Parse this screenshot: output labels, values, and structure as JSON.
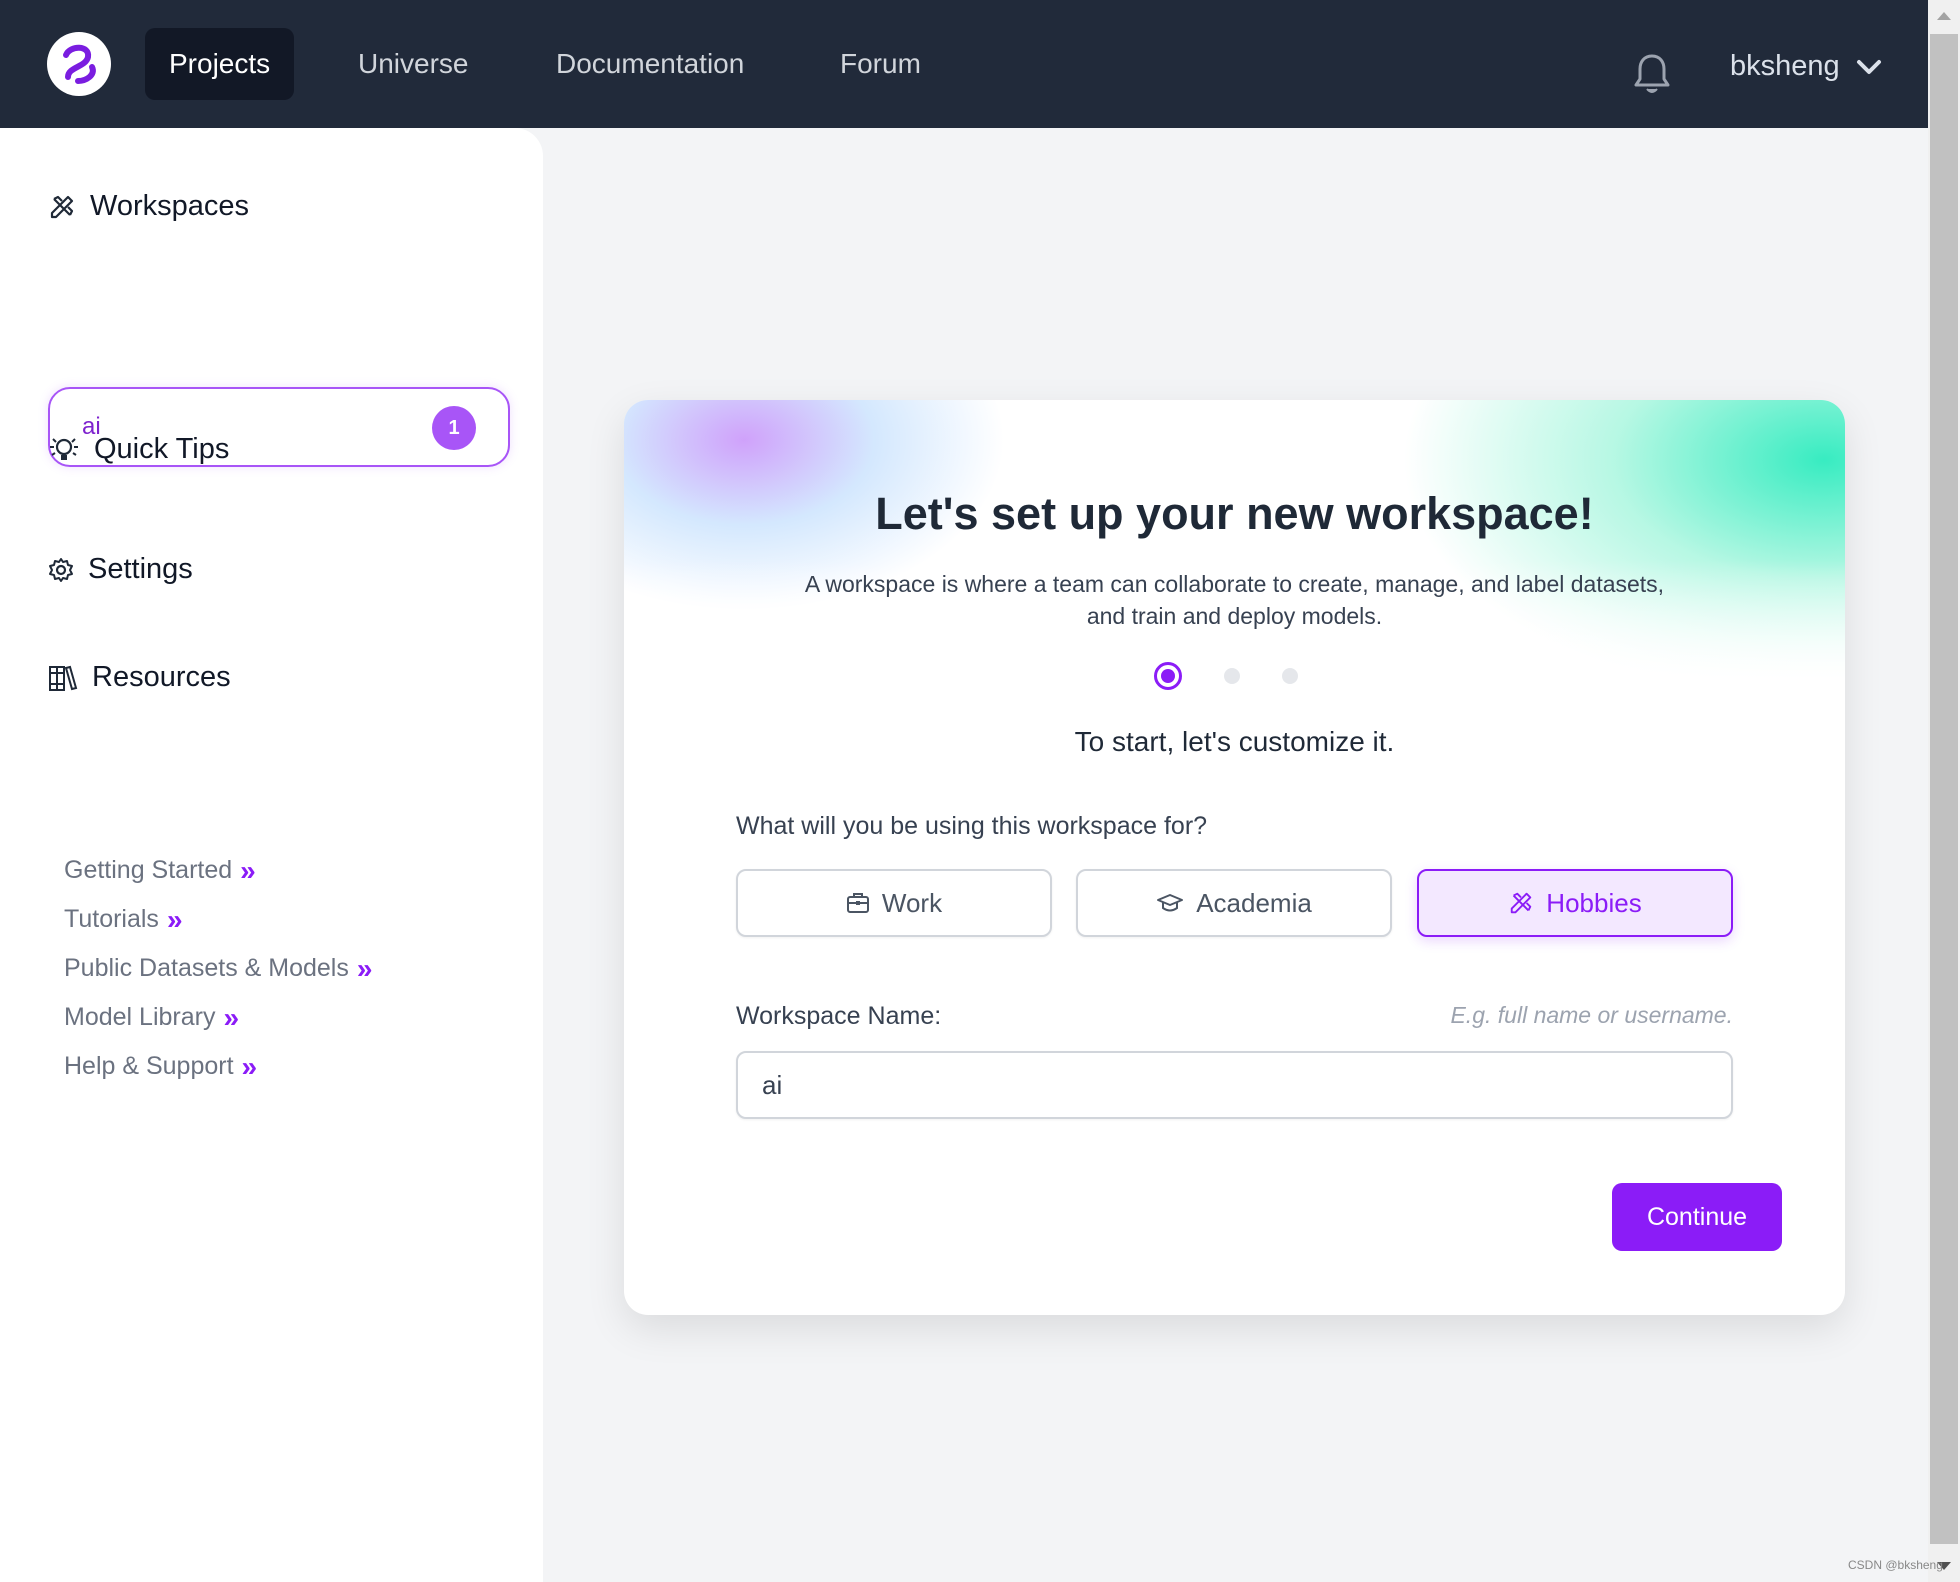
{
  "header": {
    "logo_icon": "roboflow-logo-icon",
    "nav": [
      {
        "label": "Projects",
        "active": true
      },
      {
        "label": "Universe",
        "active": false
      },
      {
        "label": "Documentation",
        "active": false
      },
      {
        "label": "Forum",
        "active": false
      }
    ],
    "notification_icon": "bell-icon",
    "username": "bksheng",
    "user_menu_icon": "chevron-down-icon"
  },
  "sidebar": {
    "workspaces": {
      "title": "Workspaces",
      "icon": "pencil-ruler-icon",
      "items": [
        {
          "name": "ai",
          "count": "1"
        }
      ]
    },
    "quick_tips": {
      "title": "Quick Tips",
      "icon": "lightbulb-icon"
    },
    "settings": {
      "title": "Settings",
      "icon": "gear-icon"
    },
    "resources": {
      "title": "Resources",
      "icon": "books-icon",
      "links": [
        {
          "label": "Getting Started"
        },
        {
          "label": "Tutorials"
        },
        {
          "label": "Public Datasets & Models"
        },
        {
          "label": "Model Library"
        },
        {
          "label": "Help & Support"
        }
      ],
      "link_icon": "double-chevron-right-icon"
    }
  },
  "card": {
    "title": "Let's set up your new workspace!",
    "subtitle": "A workspace is where a team can collaborate to create, manage, and label datasets, and train and deploy models.",
    "steps": {
      "total": 3,
      "current": 1
    },
    "prompt": "To start, let's customize it.",
    "usage_question": "What will you be using this workspace for?",
    "options": [
      {
        "label": "Work",
        "icon": "briefcase-icon",
        "selected": false
      },
      {
        "label": "Academia",
        "icon": "graduation-cap-icon",
        "selected": false
      },
      {
        "label": "Hobbies",
        "icon": "pencil-ruler-icon",
        "selected": true
      }
    ],
    "name_label": "Workspace Name:",
    "name_hint": "E.g. full name or username.",
    "name_value": "ai",
    "continue_label": "Continue"
  },
  "colors": {
    "accent": "#8b1cf7",
    "topbar": "#212a3a",
    "badge": "#a855f7"
  },
  "watermark": "CSDN @bksheng"
}
